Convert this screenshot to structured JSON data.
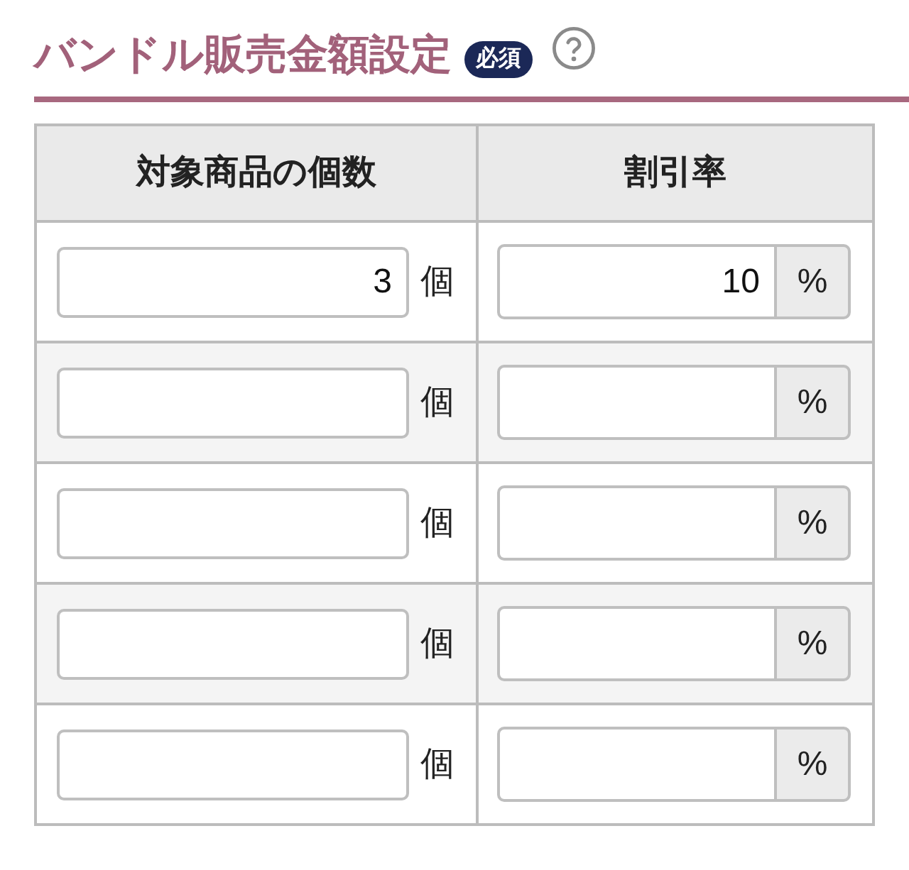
{
  "section": {
    "title": "バンドル販売金額設定",
    "badge": "必須"
  },
  "table": {
    "columns": [
      "対象商品の個数",
      "割引率"
    ],
    "rows": [
      {
        "quantity": {
          "value": "3",
          "unit": "個"
        },
        "discount": {
          "value": "10",
          "unit": "%"
        }
      },
      {
        "quantity": {
          "unit": "個"
        },
        "discount": {
          "unit": "%"
        }
      },
      {
        "quantity": {
          "unit": "個"
        },
        "discount": {
          "unit": "%"
        }
      },
      {
        "quantity": {
          "unit": "個"
        },
        "discount": {
          "unit": "%"
        }
      },
      {
        "quantity": {
          "unit": "個"
        },
        "discount": {
          "unit": "%"
        }
      }
    ]
  }
}
